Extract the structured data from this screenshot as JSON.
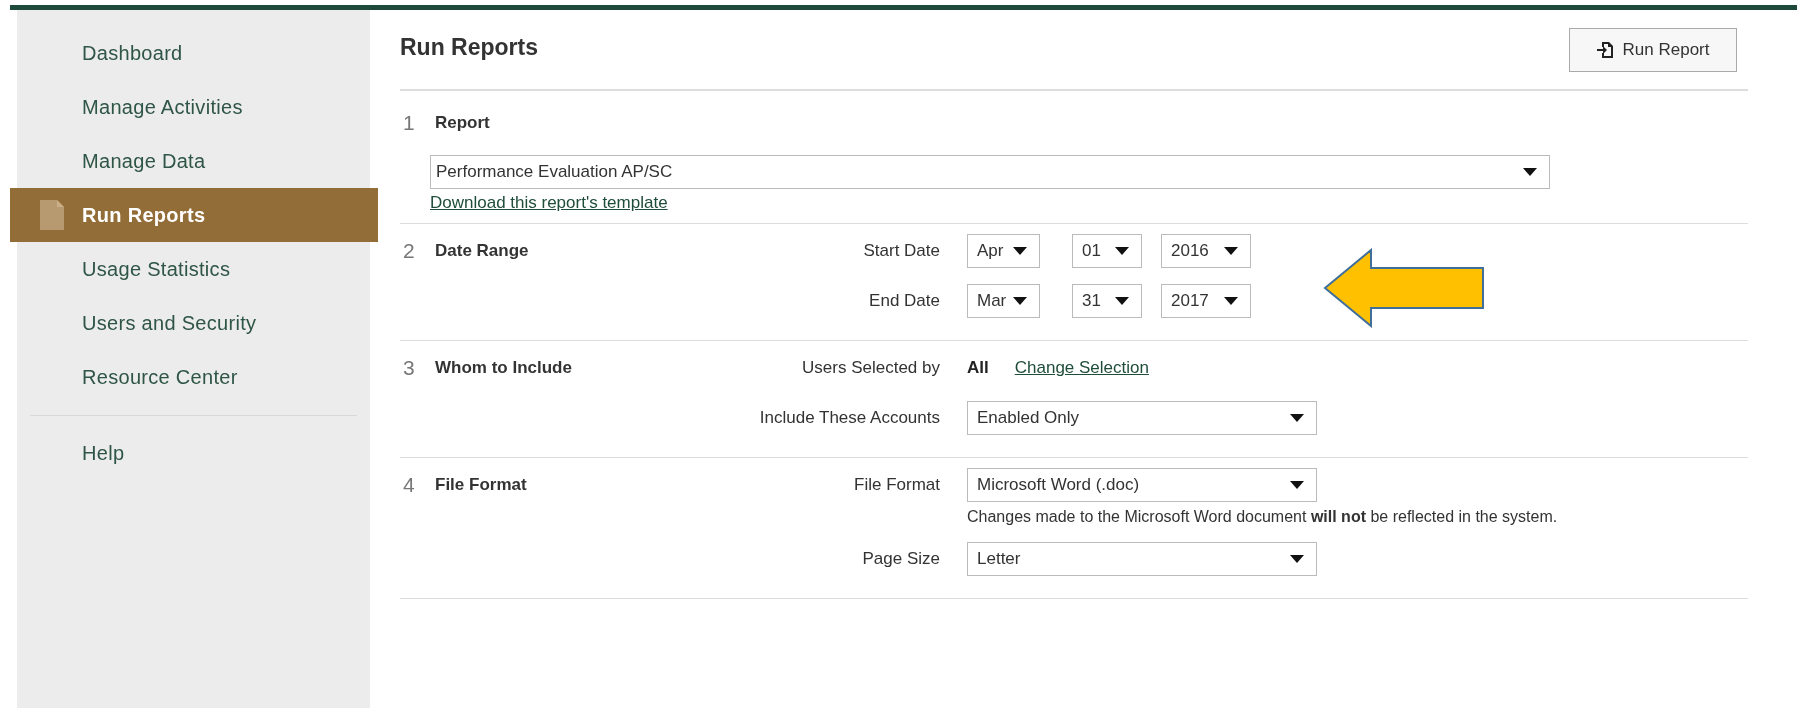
{
  "sidebar": {
    "items": [
      {
        "label": "Dashboard",
        "selected": false
      },
      {
        "label": "Manage Activities",
        "selected": false
      },
      {
        "label": "Manage Data",
        "selected": false
      },
      {
        "label": "Run Reports",
        "selected": true
      },
      {
        "label": "Usage Statistics",
        "selected": false
      },
      {
        "label": "Users and Security",
        "selected": false
      },
      {
        "label": "Resource Center",
        "selected": false
      }
    ],
    "footer_items": [
      {
        "label": "Help",
        "selected": false
      }
    ]
  },
  "page": {
    "title": "Run Reports",
    "run_button": "Run Report"
  },
  "sections": [
    {
      "number": "1",
      "title": "Report",
      "kind": "report",
      "select": "Performance Evaluation AP/SC",
      "link": "Download this report's template"
    },
    {
      "number": "2",
      "title": "Date Range",
      "kind": "fields",
      "callout": {
        "kind": "arrow"
      },
      "rows": [
        {
          "label": "Start Date",
          "kind": "date",
          "selects": [
            "Apr",
            "01",
            "2016"
          ]
        },
        {
          "label": "End Date",
          "kind": "date",
          "selects": [
            "Mar",
            "31",
            "2017"
          ]
        }
      ]
    },
    {
      "number": "3",
      "title": "Whom to Include",
      "kind": "fields",
      "rows": [
        {
          "label": "Users Selected by",
          "kind": "value_link",
          "value": "All",
          "link": "Change Selection"
        },
        {
          "label": "Include These Accounts",
          "kind": "select",
          "value": "Enabled Only"
        }
      ]
    },
    {
      "number": "4",
      "title": "File Format",
      "kind": "fields",
      "rows": [
        {
          "label": "File Format",
          "kind": "select",
          "value": "Microsoft Word (.doc)",
          "note": "Changes made to the Microsoft Word document **will not** be reflected in the system."
        },
        {
          "label": "Page Size",
          "kind": "select",
          "value": "Letter"
        }
      ]
    }
  ]
}
